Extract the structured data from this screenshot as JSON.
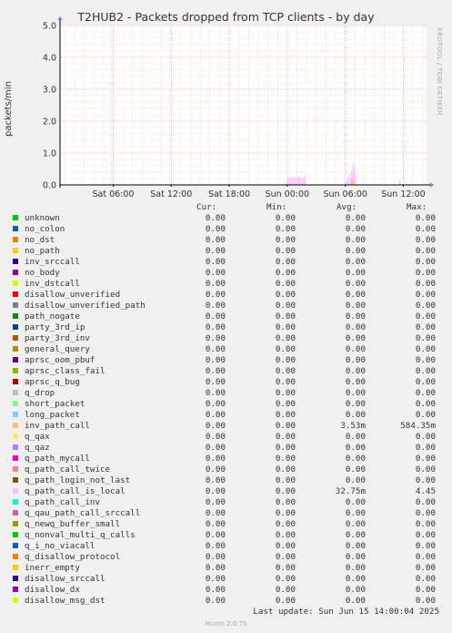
{
  "title": "T2HUB2 - Packets dropped from TCP clients - by day",
  "side_text": "RRDTOOL / TOBI OETIKER",
  "footer": {
    "last_update": "Last update: Sun Jun 15 14:00:04 2025",
    "version": "Munin 2.0.75"
  },
  "legend_headers": {
    "cur": "Cur:",
    "min": "Min:",
    "avg": "Avg:",
    "max": "Max:"
  },
  "chart_data": {
    "type": "area",
    "title": "T2HUB2 - Packets dropped from TCP clients - by day",
    "ylabel": "packets/min",
    "xlabel": "",
    "ylim": [
      0,
      5.0
    ],
    "yticks": [
      "0.0",
      "1.0",
      "2.0",
      "3.0",
      "4.0",
      "5.0"
    ],
    "ytick_values": [
      0,
      1,
      2,
      3,
      4,
      5
    ],
    "xticks": [
      "Sat 06:00",
      "Sat 12:00",
      "Sat 18:00",
      "Sun 00:00",
      "Sun 06:00",
      "Sun 12:00"
    ],
    "xtick_hours": [
      6,
      12,
      18,
      24,
      30,
      36
    ],
    "x_range_hours": [
      0.5,
      38.4
    ],
    "grid": true,
    "legend_position": "bottom",
    "series": [
      {
        "name": "unknown",
        "color": "#00cc00",
        "cur": "0.00",
        "min": "0.00",
        "avg": "0.00",
        "max": "0.00"
      },
      {
        "name": "no_colon",
        "color": "#0066b3",
        "cur": "0.00",
        "min": "0.00",
        "avg": "0.00",
        "max": "0.00"
      },
      {
        "name": "no_dst",
        "color": "#ff8000",
        "cur": "0.00",
        "min": "0.00",
        "avg": "0.00",
        "max": "0.00"
      },
      {
        "name": "no_path",
        "color": "#ffcc00",
        "cur": "0.00",
        "min": "0.00",
        "avg": "0.00",
        "max": "0.00"
      },
      {
        "name": "inv_srccall",
        "color": "#330099",
        "cur": "0.00",
        "min": "0.00",
        "avg": "0.00",
        "max": "0.00"
      },
      {
        "name": "no_body",
        "color": "#990099",
        "cur": "0.00",
        "min": "0.00",
        "avg": "0.00",
        "max": "0.00"
      },
      {
        "name": "inv_dstcall",
        "color": "#ccff00",
        "cur": "0.00",
        "min": "0.00",
        "avg": "0.00",
        "max": "0.00"
      },
      {
        "name": "disallow_unverified",
        "color": "#ff0000",
        "cur": "0.00",
        "min": "0.00",
        "avg": "0.00",
        "max": "0.00"
      },
      {
        "name": "disallow_unverified_path",
        "color": "#808080",
        "cur": "0.00",
        "min": "0.00",
        "avg": "0.00",
        "max": "0.00"
      },
      {
        "name": "path_nogate",
        "color": "#008f00",
        "cur": "0.00",
        "min": "0.00",
        "avg": "0.00",
        "max": "0.00"
      },
      {
        "name": "party_3rd_ip",
        "color": "#00487d",
        "cur": "0.00",
        "min": "0.00",
        "avg": "0.00",
        "max": "0.00"
      },
      {
        "name": "party_3rd_inv",
        "color": "#b35a00",
        "cur": "0.00",
        "min": "0.00",
        "avg": "0.00",
        "max": "0.00"
      },
      {
        "name": "general_query",
        "color": "#b38f00",
        "cur": "0.00",
        "min": "0.00",
        "avg": "0.00",
        "max": "0.00"
      },
      {
        "name": "aprsc_oom_pbuf",
        "color": "#6b006b",
        "cur": "0.00",
        "min": "0.00",
        "avg": "0.00",
        "max": "0.00"
      },
      {
        "name": "aprsc_class_fail",
        "color": "#8fb300",
        "cur": "0.00",
        "min": "0.00",
        "avg": "0.00",
        "max": "0.00"
      },
      {
        "name": "aprsc_q_bug",
        "color": "#b30000",
        "cur": "0.00",
        "min": "0.00",
        "avg": "0.00",
        "max": "0.00"
      },
      {
        "name": "q_drop",
        "color": "#bebebe",
        "cur": "0.00",
        "min": "0.00",
        "avg": "0.00",
        "max": "0.00"
      },
      {
        "name": "short_packet",
        "color": "#80ff80",
        "cur": "0.00",
        "min": "0.00",
        "avg": "0.00",
        "max": "0.00"
      },
      {
        "name": "long_packet",
        "color": "#80c9ff",
        "cur": "0.00",
        "min": "0.00",
        "avg": "0.00",
        "max": "0.00"
      },
      {
        "name": "inv_path_call",
        "color": "#ffc080",
        "cur": "0.00",
        "min": "0.00",
        "avg": "3.53m",
        "max": "584.35m",
        "avg_value": 0.00353,
        "max_value": 0.58435
      },
      {
        "name": "q_qax",
        "color": "#ffe680",
        "cur": "0.00",
        "min": "0.00",
        "avg": "0.00",
        "max": "0.00"
      },
      {
        "name": "q_qaz",
        "color": "#aa80ff",
        "cur": "0.00",
        "min": "0.00",
        "avg": "0.00",
        "max": "0.00"
      },
      {
        "name": "q_path_mycall",
        "color": "#ee00cc",
        "cur": "0.00",
        "min": "0.00",
        "avg": "0.00",
        "max": "0.00"
      },
      {
        "name": "q_path_call_twice",
        "color": "#ff8080",
        "cur": "0.00",
        "min": "0.00",
        "avg": "0.00",
        "max": "0.00"
      },
      {
        "name": "q_path_login_not_last",
        "color": "#666600",
        "cur": "0.00",
        "min": "0.00",
        "avg": "0.00",
        "max": "0.00"
      },
      {
        "name": "q_path_call_is_local",
        "color": "#ffbfff",
        "cur": "0.00",
        "min": "0.00",
        "avg": "32.75m",
        "max": "4.45",
        "avg_value": 0.03275,
        "max_value": 4.45
      },
      {
        "name": "q_path_call_inv",
        "color": "#00ffcc",
        "cur": "0.00",
        "min": "0.00",
        "avg": "0.00",
        "max": "0.00"
      },
      {
        "name": "q_qau_path_call_srccall",
        "color": "#cc6699",
        "cur": "0.00",
        "min": "0.00",
        "avg": "0.00",
        "max": "0.00"
      },
      {
        "name": "q_newq_buffer_small",
        "color": "#999900",
        "cur": "0.00",
        "min": "0.00",
        "avg": "0.00",
        "max": "0.00"
      },
      {
        "name": "q_nonval_multi_q_calls",
        "color": "#00cc00",
        "cur": "0.00",
        "min": "0.00",
        "avg": "0.00",
        "max": "0.00"
      },
      {
        "name": "q_i_no_viacall",
        "color": "#0066b3",
        "cur": "0.00",
        "min": "0.00",
        "avg": "0.00",
        "max": "0.00"
      },
      {
        "name": "q_disallow_protocol",
        "color": "#ff8000",
        "cur": "0.00",
        "min": "0.00",
        "avg": "0.00",
        "max": "0.00"
      },
      {
        "name": "inerr_empty",
        "color": "#ffcc00",
        "cur": "0.00",
        "min": "0.00",
        "avg": "0.00",
        "max": "0.00"
      },
      {
        "name": "disallow_srccall",
        "color": "#330099",
        "cur": "0.00",
        "min": "0.00",
        "avg": "0.00",
        "max": "0.00"
      },
      {
        "name": "disallow_dx",
        "color": "#990099",
        "cur": "0.00",
        "min": "0.00",
        "avg": "0.00",
        "max": "0.00"
      },
      {
        "name": "disallow_msg_dst",
        "color": "#ccff00",
        "cur": "0.00",
        "min": "0.00",
        "avg": "0.00",
        "max": "0.00"
      }
    ],
    "spikes": [
      {
        "series": "q_path_call_is_local",
        "hours": [
          [
            24.0,
            0.22
          ],
          [
            24.15,
            0.25
          ],
          [
            24.3,
            0.25
          ],
          [
            24.45,
            0.22
          ],
          [
            24.6,
            0.25
          ],
          [
            24.75,
            0.25
          ],
          [
            24.9,
            0.22
          ],
          [
            25.05,
            0.25
          ],
          [
            25.2,
            0.25
          ],
          [
            25.35,
            0.22
          ],
          [
            25.5,
            0.25
          ],
          [
            25.65,
            0.22
          ],
          [
            25.8,
            0.28
          ],
          [
            30.1,
            0.12
          ],
          [
            30.2,
            0.22
          ],
          [
            30.35,
            0.35
          ],
          [
            30.5,
            0.22
          ],
          [
            30.6,
            0.45
          ],
          [
            30.75,
            0.7
          ],
          [
            30.9,
            0.55
          ],
          [
            31.0,
            0.3
          ],
          [
            35.6,
            0.15
          ]
        ]
      },
      {
        "series": "inv_path_call",
        "hours": [
          [
            30.55,
            0.12
          ],
          [
            30.7,
            0.22
          ],
          [
            30.8,
            0.1
          ]
        ]
      }
    ]
  }
}
